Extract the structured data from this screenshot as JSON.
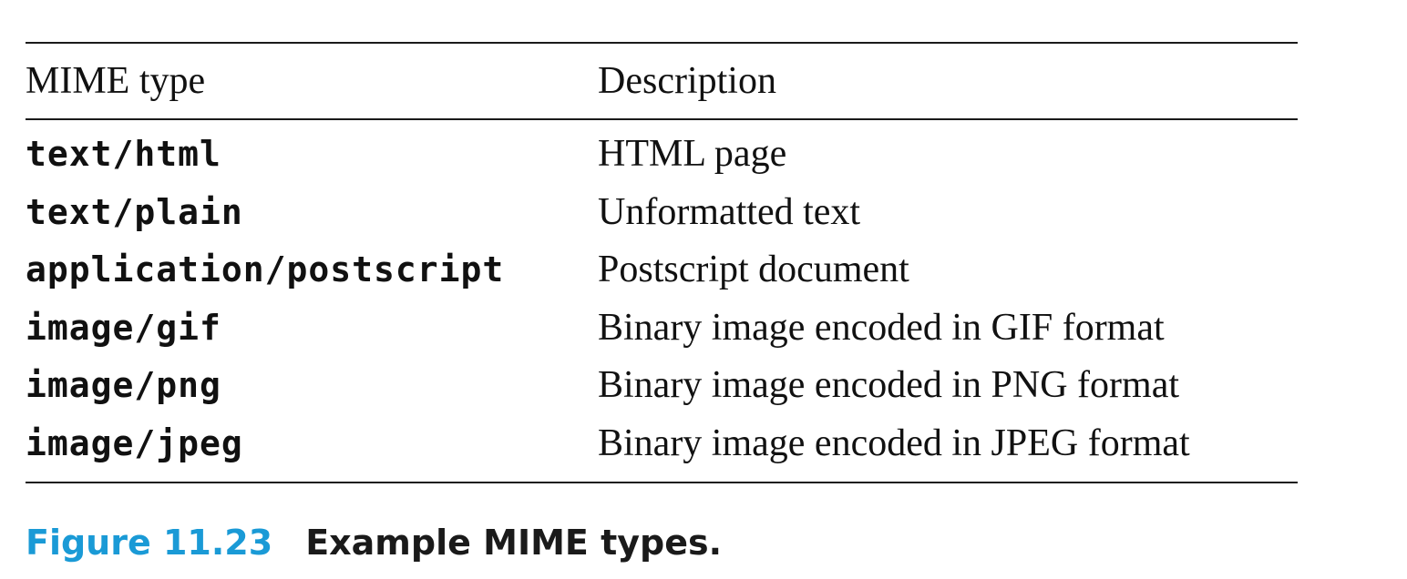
{
  "table": {
    "headers": {
      "mime_type": "MIME type",
      "description": "Description"
    },
    "rows": [
      {
        "mime_type": "text/html",
        "description": "HTML page"
      },
      {
        "mime_type": "text/plain",
        "description": "Unformatted text"
      },
      {
        "mime_type": "application/postscript",
        "description": "Postscript document"
      },
      {
        "mime_type": "image/gif",
        "description": "Binary image encoded in GIF format"
      },
      {
        "mime_type": "image/png",
        "description": "Binary image encoded in PNG format"
      },
      {
        "mime_type": "image/jpeg",
        "description": "Binary image encoded in JPEG format"
      }
    ]
  },
  "caption": {
    "label": "Figure 11.23",
    "text": "Example MIME types."
  },
  "colors": {
    "caption_label": "#1a9ad6",
    "text": "#111111"
  }
}
